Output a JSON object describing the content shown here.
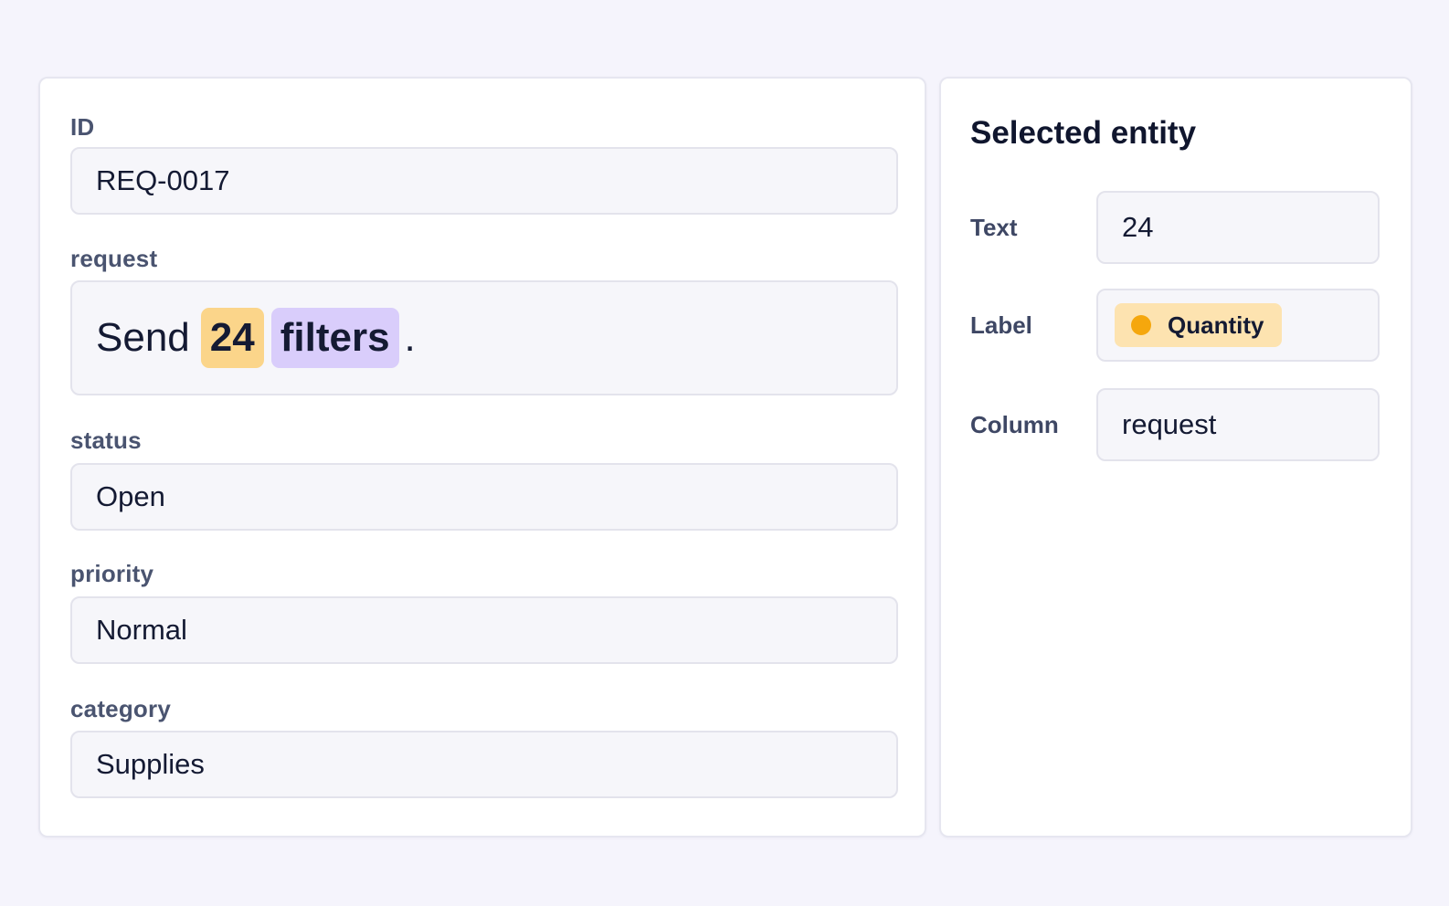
{
  "record": {
    "fields": [
      {
        "label": "ID",
        "value": "REQ-0017"
      },
      {
        "label": "request"
      },
      {
        "label": "status",
        "value": "Open"
      },
      {
        "label": "priority",
        "value": "Normal"
      },
      {
        "label": "category",
        "value": "Supplies"
      }
    ],
    "request_tokens": {
      "word1": "Send",
      "quantity": "24",
      "product": "filters",
      "punct": "."
    }
  },
  "entity_panel": {
    "title": "Selected entity",
    "text_label": "Text",
    "text_value": "24",
    "label_label": "Label",
    "label_value": "Quantity",
    "label_color": "#f5a70d",
    "column_label": "Column",
    "column_value": "request"
  },
  "colors": {
    "quantity_highlight": "#fbd58a",
    "product_highlight": "#d9cdfb"
  }
}
